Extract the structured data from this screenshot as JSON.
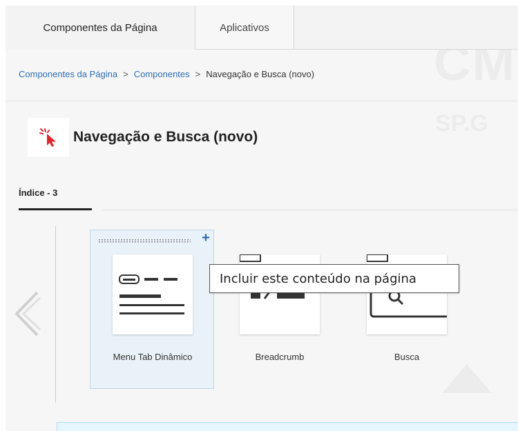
{
  "top_tabs": [
    {
      "label": "Componentes da Página",
      "active": true
    },
    {
      "label": "Aplicativos",
      "active": false
    }
  ],
  "breadcrumb": {
    "items": [
      "Componentes da Página",
      "Componentes",
      "Navegação e Busca (novo)"
    ],
    "separator": ">"
  },
  "title": {
    "text": "Navegação e Busca (novo)",
    "icon": "pointer-click-icon"
  },
  "index_tab": {
    "label": "Índice - 3"
  },
  "components": [
    {
      "label": "Menu Tab Dinâmico",
      "icon": "menu-tab-icon",
      "selected": true
    },
    {
      "label": "Breadcrumb",
      "icon": "breadcrumb-icon",
      "selected": false
    },
    {
      "label": "Busca",
      "icon": "search-box-icon",
      "selected": false
    }
  ],
  "tooltip": {
    "text": "Incluir este conteúdo na página"
  },
  "colors": {
    "link": "#2f6eb5",
    "selected_card_bg": "#e9f2f8",
    "icon_red": "#e8232a",
    "bottom_box_bg": "#e6f6fd"
  }
}
